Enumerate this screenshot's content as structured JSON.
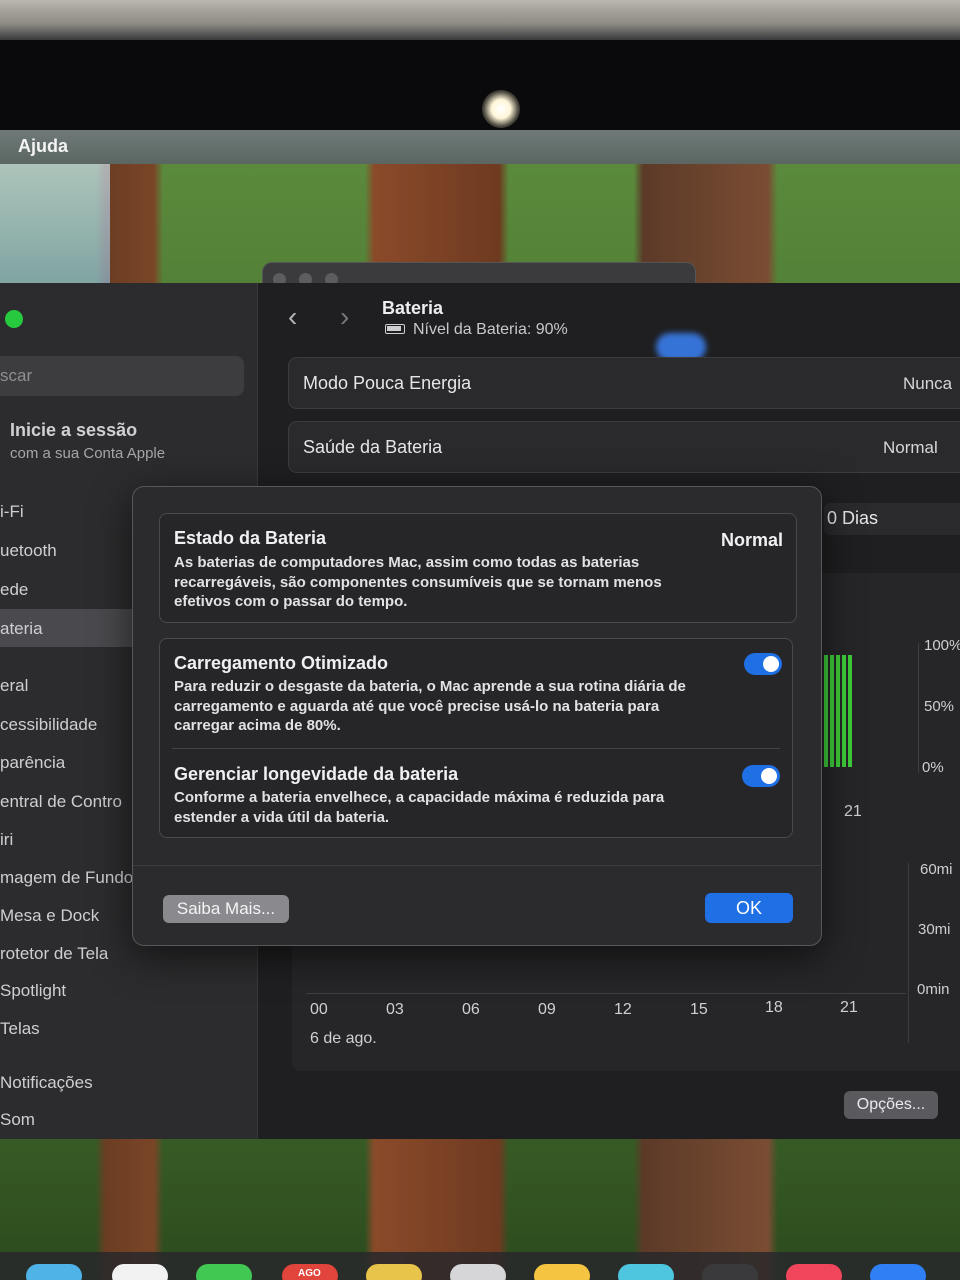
{
  "menubar": {
    "help_label": "Ajuda"
  },
  "sidebar": {
    "search_placeholder": "scar",
    "signin_title": "Inicie a sessão",
    "signin_subtitle": "com a sua Conta Apple",
    "items": [
      {
        "label": "i-Fi"
      },
      {
        "label": "uetooth"
      },
      {
        "label": "ede"
      },
      {
        "label": "ateria"
      },
      {
        "label": "eral"
      },
      {
        "label": "cessibilidade"
      },
      {
        "label": "parência"
      },
      {
        "label": "entral de Contro"
      },
      {
        "label": "iri"
      },
      {
        "label": "magem de Fundo"
      },
      {
        "label": "Mesa e Dock"
      },
      {
        "label": "rotetor de Tela"
      },
      {
        "label": "Spotlight"
      },
      {
        "label": "Telas"
      },
      {
        "label": "Notificações"
      },
      {
        "label": "Som"
      }
    ],
    "selected_item": "ateria"
  },
  "header": {
    "title": "Bateria",
    "battery_level": "Nível da Bateria: 90%"
  },
  "rows": {
    "low_power_label": "Modo Pouca Energia",
    "low_power_value": "Nunca",
    "health_label": "Saúde da Bateria",
    "health_value": "Normal"
  },
  "usage": {
    "range_label": "0 Dias",
    "percent_ticks": [
      "100%",
      "50%",
      "0%"
    ],
    "upper_tick": "21",
    "minute_ticks": [
      "60mi",
      "30mi",
      "0min"
    ],
    "hour_ticks": [
      "00",
      "03",
      "06",
      "09",
      "12",
      "15",
      "18",
      "21"
    ],
    "date_label": "6 de ago.",
    "options_button": "Opções..."
  },
  "dialog": {
    "status_title": "Estado da Bateria",
    "status_value": "Normal",
    "status_desc": "As baterias de computadores Mac, assim como todas as baterias recarregáveis, são componentes consumíveis que se tornam menos efetivos com o passar do tempo.",
    "optimized_title": "Carregamento Otimizado",
    "optimized_desc": "Para reduzir o desgaste da bateria, o Mac aprende a sua rotina diária de carregamento e aguarda até que você precise usá-lo na bateria para carregar acima de 80%.",
    "optimized_on": true,
    "longevity_title": "Gerenciar longevidade da bateria",
    "longevity_desc": "Conforme a bateria envelhece, a capacidade máxima é reduzida para estender a vida útil da bateria.",
    "longevity_on": true,
    "learn_more_button": "Saiba Mais...",
    "ok_button": "OK"
  },
  "dock": {
    "calendar_badge": "AGO"
  },
  "colors": {
    "accent": "#1f6fe5",
    "chart_bar": "#3fcf3a",
    "window_bg": "#1f1f21",
    "traffic_green": "#27c93f"
  }
}
